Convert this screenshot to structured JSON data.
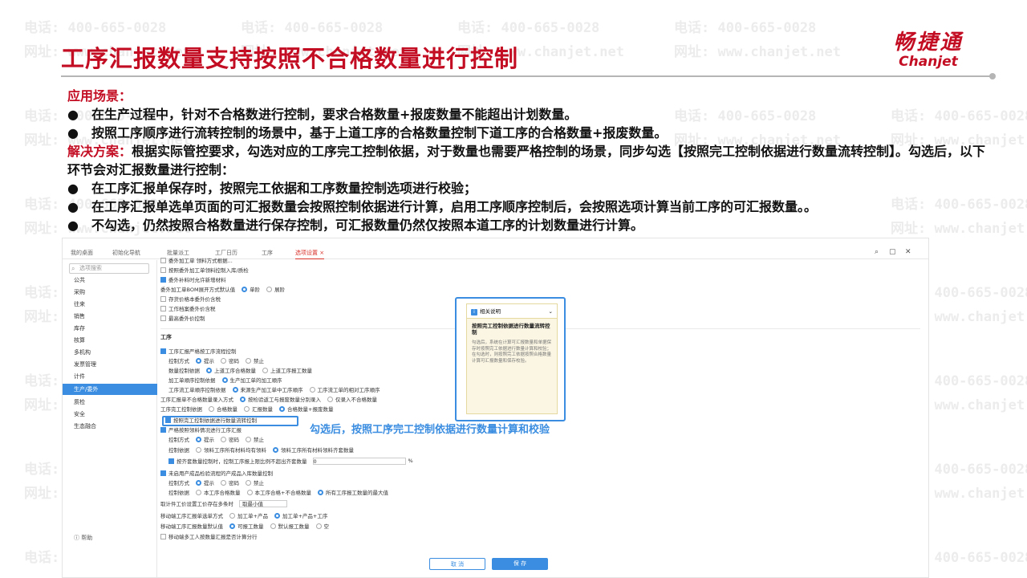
{
  "watermark": {
    "phone": "电话: 400-665-0028",
    "site": "网址: www.chanjet.net"
  },
  "slide": {
    "title": "工序汇报数量支持按照不合格数量进行控制",
    "logo_cn": "畅捷通",
    "logo_en": "Chanjet"
  },
  "content": {
    "scenario_label": "应用场景：",
    "scenario_items": [
      "在生产过程中，针对不合格数进行控制，要求合格数量+报废数量不能超出计划数量。",
      "按照工序顺序进行流转控制的场景中，基于上道工序的合格数量控制下道工序的合格数量+报废数量。"
    ],
    "solution_label": "解决方案：",
    "solution_text": "根据实际管控要求，勾选对应的工序完工控制依据，对于数量也需要严格控制的场景，同步勾选【按照完工控制依据进行数量流转控制】。勾选后，以下环节会对汇报数量进行控制：",
    "solution_items": [
      "在工序汇报单保存时，按照完工依据和工序数量控制选项进行校验；",
      "在工序汇报单选单页面的可汇报数量会按照控制依据进行计算，启用工序顺序控制后，会按照选项计算当前工序的可汇报数量。。",
      "不勾选，仍然按照合格数量进行保存控制，可汇报数量仍然仅按照本道工序的计划数量进行计算。"
    ]
  },
  "app": {
    "tabs": [
      "我的桌面",
      "初始化导航",
      "批量派工",
      "工厂日历",
      "工序",
      "选项设置"
    ],
    "active_tab": "选项设置",
    "search_placeholder": "选项搜索",
    "sidebar": [
      "公共",
      "采购",
      "往来",
      "销售",
      "库存",
      "核算",
      "多机构",
      "发票管理",
      "计件",
      "生产/委外",
      "质检",
      "安全",
      "生态融合"
    ],
    "active_sidebar": "生产/委外",
    "help": "帮助",
    "rows": {
      "r0": "委外加工单 领料方式根据...",
      "r1": "按照委外加工单领料控制入库/质检",
      "r2": "委外补料时允许新增材料",
      "r3": "委外加工单BOM展开方式默认值",
      "r3a": "单阶",
      "r3b": "展阶",
      "r4": "存货价格本委外价含税",
      "r5": "工作档案委外价含税",
      "r6": "最高委外价控制",
      "section": "工序",
      "r7": "工序汇报严格按工序流程控制",
      "r8": "控制方式",
      "opt_tip": "提示",
      "opt_pwd": "密码",
      "opt_ban": "禁止",
      "r9": "数量控制依据",
      "r9a": "上道工序合格数量",
      "r9b": "上道工序报工数量",
      "r10": "加工单顺序控制依据",
      "r10a": "生产加工单的加工顺序",
      "r11": "工序流工单顺序控制依据",
      "r11a": "来源生产加工单中工序顺序",
      "r11b": "工序流工单的相对工序顺序",
      "r12": "工序汇报单不合格数量录入方式",
      "r12a": "按检验返工与报废数量分别录入",
      "r12b": "仅录入不合格数量",
      "r13": "工序完工控制依据",
      "r13a": "合格数量",
      "r13b": "汇报数量",
      "r13c": "合格数量+报废数量",
      "r14": "按照完工控制依据进行数量流转控制",
      "r15": "严格按照领料情况进行工序汇报",
      "r16": "控制方式",
      "r17": "控制依据",
      "r17a": "领料工序所有材料均有领料",
      "r17b": "领料工序所有材料领料齐套数量",
      "r18": "按齐套数量控制时，控制工序报上限比例不超出齐套数量",
      "r18v": "0",
      "r18u": "%",
      "r19": "未启用产成品检验流程的产成品入库数量控制",
      "r20": "控制方式",
      "r21": "控制依据",
      "r21a": "本工序合格数量",
      "r21b": "本工序合格+不合格数量",
      "r21c": "所有工序报工数量的最大值",
      "r22": "取计件工价设置工价存在多条时",
      "r22v": "取最小值",
      "r23": "移动端工序汇报单选单方式",
      "r23a": "加工单+产品",
      "r23b": "加工单+产品+工序",
      "r24": "移动端工序汇报数量默认值",
      "r24a": "可报工数量",
      "r24b": "默认报工数量",
      "r24c": "空",
      "r25": "移动端多工人按数量汇报是否计算分行"
    },
    "popup": {
      "header": "相关说明",
      "title": "按照完工控制依据进行数量流转控制",
      "body": "勾选后，系统在计算可汇报数量和单据保存时按照完工依据进行数量计算和校验；在勾选时，则按照完工依据按照合格数量计算可汇报数量和保存校验。"
    },
    "callout": "勾选后，按照工序完工控制依据进行数量计算和校验",
    "cancel": "取 消",
    "save": "保 存"
  },
  "colors": {
    "brand_red": "#c30d23",
    "accent_blue": "#3a8de0"
  }
}
